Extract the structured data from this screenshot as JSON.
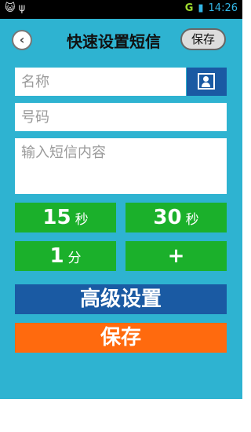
{
  "status": {
    "left_icons": "😺 ψ",
    "network": "G",
    "battery": "▮",
    "time": "14:26"
  },
  "header": {
    "title": "快速设置短信",
    "save_label": "保存"
  },
  "form": {
    "name_placeholder": "名称",
    "number_placeholder": "号码",
    "content_placeholder": "输入短信内容"
  },
  "quick_buttons": [
    {
      "value": "15",
      "unit": "秒"
    },
    {
      "value": "30",
      "unit": "秒"
    },
    {
      "value": "1",
      "unit": "分"
    },
    {
      "value": "+",
      "unit": ""
    }
  ],
  "advanced_label": "高级设置",
  "save_label": "保存",
  "colors": {
    "background": "#2eb3d1",
    "green": "#1bb02b",
    "blue": "#1a5aa3",
    "orange": "#ff6a0e"
  }
}
